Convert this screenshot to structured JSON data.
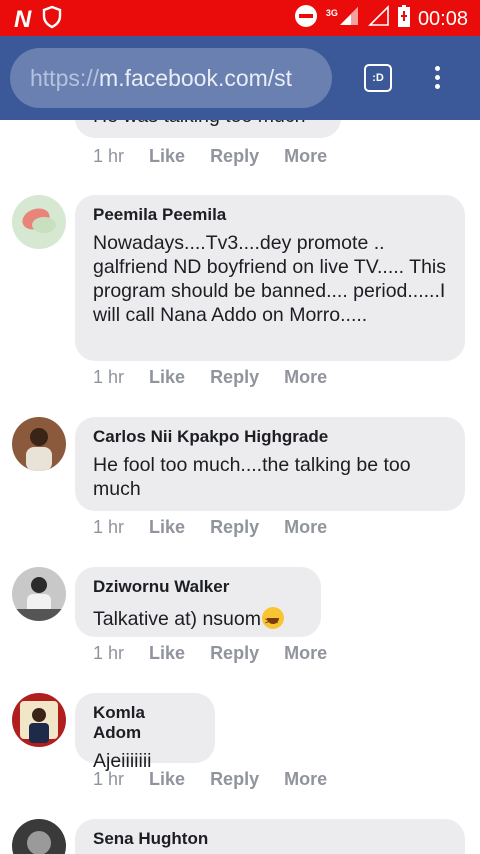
{
  "status_bar": {
    "logo": "N",
    "network": "3G",
    "time": "00:08",
    "icons": [
      "n-logo-icon",
      "shield-icon",
      "do-not-disturb-icon",
      "signal-icon",
      "signal-empty-icon",
      "battery-icon"
    ]
  },
  "browser": {
    "url_proto": "https://",
    "url_rest": "m.facebook.com/st",
    "tab_label": ":D"
  },
  "partial_comment": {
    "text": "He was talking too much",
    "actions": {
      "time": "1 hr",
      "like": "Like",
      "reply": "Reply",
      "more": "More"
    }
  },
  "comments": [
    {
      "author": "Peemila Peemila",
      "text": "Nowadays....Tv3....dey promote .. galfriend ND boyfriend on live TV..... This program should be banned.... period......I will call Nana Addo on Morro.....",
      "actions": {
        "time": "1 hr",
        "like": "Like",
        "reply": "Reply",
        "more": "More"
      }
    },
    {
      "author": "Carlos Nii Kpakpo Highgrade",
      "text": "He fool too much....the talking be too much",
      "actions": {
        "time": "1 hr",
        "like": "Like",
        "reply": "Reply",
        "more": "More"
      }
    },
    {
      "author": "Dziwornu Walker",
      "text": "Talkative at) nsuom",
      "emoji": "laughing-emoji",
      "actions": {
        "time": "1 hr",
        "like": "Like",
        "reply": "Reply",
        "more": "More"
      }
    },
    {
      "author": "Komla Adom",
      "text": "Ajeiiiiiii",
      "actions": {
        "time": "1 hr",
        "like": "Like",
        "reply": "Reply",
        "more": "More"
      }
    },
    {
      "author": "Sena Hughton"
    }
  ],
  "colors": {
    "status_bar": "#ea0b0b",
    "browser_bar": "#3b5998",
    "bubble": "#ececef",
    "action_text": "#90949c"
  }
}
